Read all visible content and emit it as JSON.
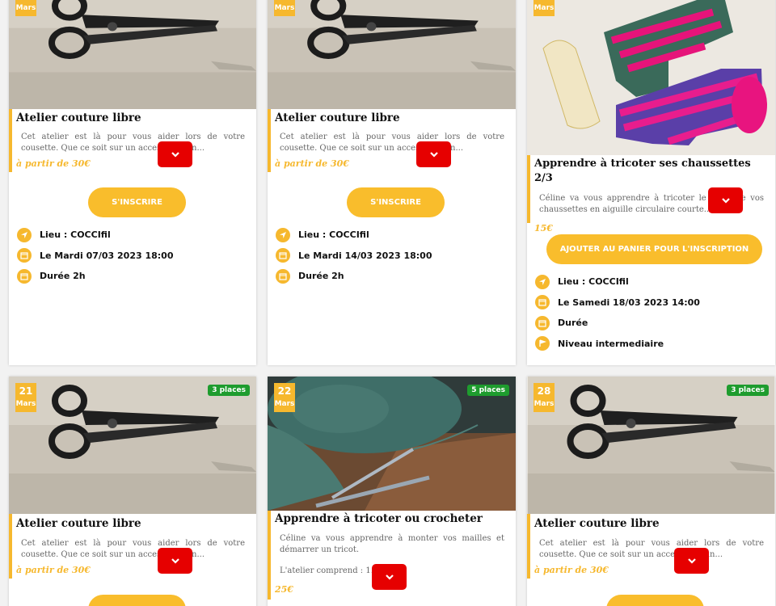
{
  "cards": [
    {
      "month": "Mars",
      "title": "Atelier couture libre",
      "desc": "Cet atelier est là pour vous aider lors de votre cousette. Que ce soit sur un accessoire, un...",
      "price": "à partir de 30€",
      "cta": "S'inscrire",
      "lieu": "Lieu : COCCIfil",
      "date": "Le Mardi 07/03 2023 18:00",
      "duree": "Durée 2h"
    },
    {
      "month": "Mars",
      "title": "Atelier couture libre",
      "desc": "Cet atelier est là pour vous aider lors de votre cousette. Que ce soit sur un accessoire, un...",
      "price": "à partir de 30€",
      "cta": "S'inscrire",
      "lieu": "Lieu : COCCIfil",
      "date": "Le Mardi 14/03 2023 18:00",
      "duree": "Durée 2h"
    },
    {
      "month": "Mars",
      "title": "Apprendre à tricoter ses chaussettes 2/3",
      "desc": "Céline va vous apprendre à tricoter le talon de vos chaussettes en aiguille circulaire courte...",
      "price": "15€",
      "cta": "Ajouter au panier pour l'inscription",
      "lieu": "Lieu : COCCIfil",
      "date": "Le Samedi 18/03 2023 14:00",
      "duree": "Durée",
      "niveau": "Niveau intermediaire"
    },
    {
      "day": "21",
      "month": "Mars",
      "places": "3 places",
      "title": "Atelier couture libre",
      "desc": "Cet atelier est là pour vous aider lors de votre cousette. Que ce soit sur un accessoire, un...",
      "price": "à partir de 30€"
    },
    {
      "day": "22",
      "month": "Mars",
      "places": "5 places",
      "title": "Apprendre à tricoter ou crocheter",
      "desc": "Céline va vous apprendre à monter vos mailles et démarrer un tricot.",
      "desc2": "L'atelier comprend : 1...",
      "price": "25€"
    },
    {
      "day": "28",
      "month": "Mars",
      "places": "3 places",
      "title": "Atelier couture libre",
      "desc": "Cet atelier est là pour vous aider lors de votre cousette. Que ce soit sur un accessoire, un...",
      "price": "à partir de 30€"
    }
  ],
  "icons": {
    "expand": "chevron-down-icon",
    "lieu": "location-arrow-icon",
    "date": "calendar-icon",
    "duree": "calendar-icon",
    "niveau": "level-flag-icon"
  },
  "colors": {
    "accent": "#f6b82e",
    "expand": "#e60000",
    "places": "#1e9c2e"
  }
}
